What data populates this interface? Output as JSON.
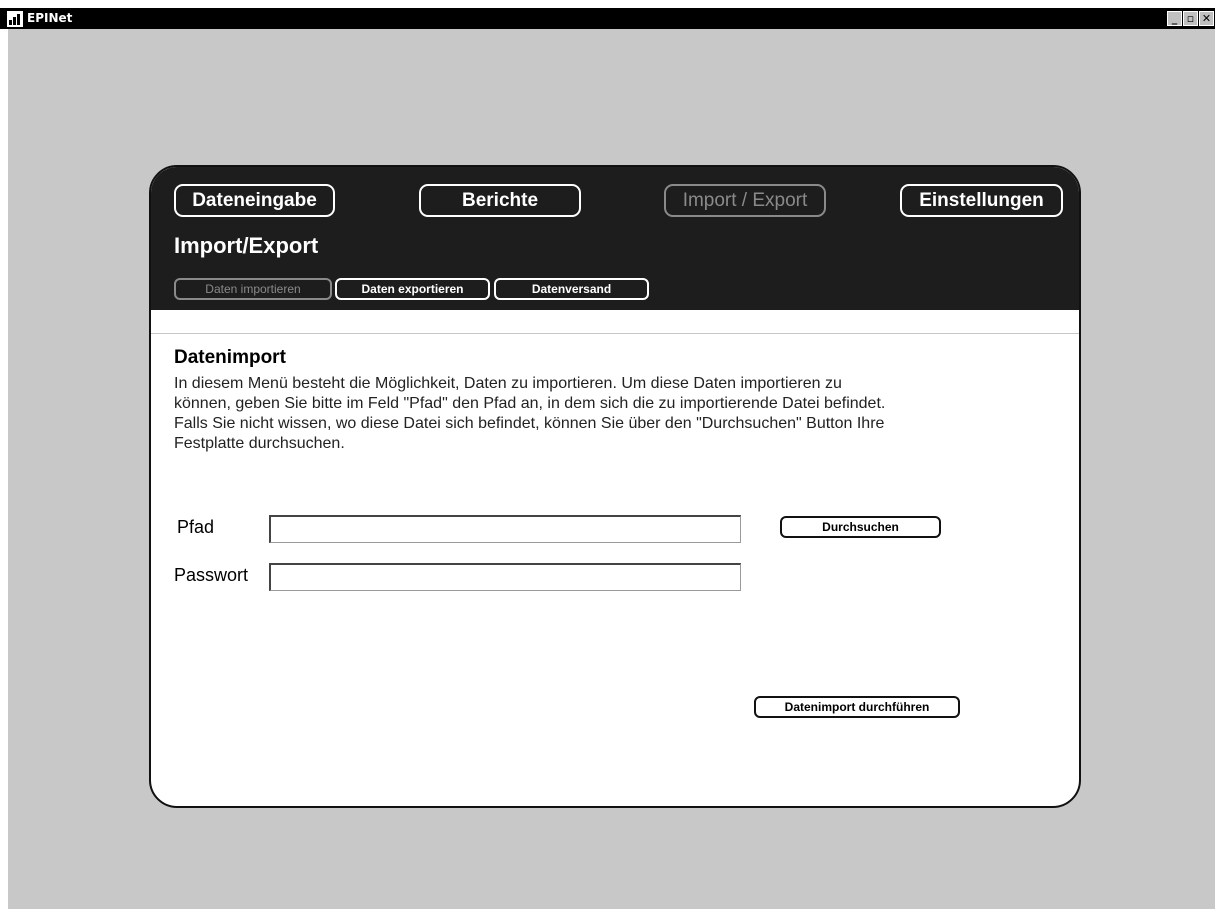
{
  "window": {
    "title": "EPINet",
    "minimize_glyph": "_",
    "maximize_glyph": "▫",
    "close_glyph": "✕"
  },
  "nav": {
    "items": [
      {
        "label": "Dateneingabe",
        "enabled": true
      },
      {
        "label": "Berichte",
        "enabled": true
      },
      {
        "label": "Import / Export",
        "enabled": false
      },
      {
        "label": "Einstellungen",
        "enabled": true
      }
    ]
  },
  "page": {
    "title": "Import/Export"
  },
  "subnav": {
    "items": [
      {
        "label": "Daten importieren",
        "enabled": false
      },
      {
        "label": "Daten exportieren",
        "enabled": true
      },
      {
        "label": "Datenversand",
        "enabled": true
      }
    ]
  },
  "section": {
    "title": "Datenimport",
    "description": "In diesem Menü besteht die Möglichkeit, Daten zu importieren. Um diese Daten importieren zu können, geben Sie bitte im Feld \"Pfad\" den Pfad an, in dem sich die zu importierende Datei befindet. Falls Sie nicht wissen, wo diese Datei sich befindet, können Sie über den \"Durchsuchen\" Button Ihre Festplatte durchsuchen."
  },
  "form": {
    "path_label": "Pfad",
    "path_value": "",
    "password_label": "Passwort",
    "password_value": "",
    "browse_label": "Durchsuchen",
    "submit_label": "Datenimport durchführen"
  },
  "colors": {
    "header_bg": "#1d1d1d",
    "desktop_bg": "#c8c8c8",
    "disabled_text": "#8a8a8a"
  }
}
